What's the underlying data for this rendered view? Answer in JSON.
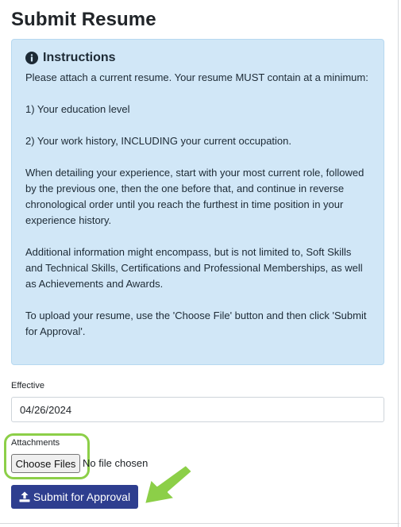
{
  "page": {
    "title": "Submit Resume"
  },
  "instructions": {
    "icon": "info-circle-icon",
    "title": "Instructions",
    "paragraphs": [
      "Please attach a current resume. Your resume MUST contain at a minimum:",
      "1) Your education level",
      "2) Your work history, INCLUDING your current occupation.",
      "When detailing your experience, start with your most current role, followed by the previous one, then the one before that, and continue in reverse chronological order until you reach the furthest in time position in your experience history.",
      "Additional information might encompass, but is not limited to, Soft Skills and Technical Skills, Certifications and Professional Memberships, as well as Achievements and Awards.",
      "To upload your resume, use the 'Choose File' button and then click 'Submit for Approval'."
    ]
  },
  "effective": {
    "label": "Effective",
    "value": "04/26/2024"
  },
  "attachments": {
    "label": "Attachments",
    "choose_label": "Choose Files",
    "status": "No file chosen"
  },
  "submit": {
    "icon": "upload-icon",
    "label": "Submit for Approval"
  },
  "colors": {
    "info_bg": "#d1e7f7",
    "submit_bg": "#2e3e8f",
    "highlight": "#8ccf48"
  }
}
